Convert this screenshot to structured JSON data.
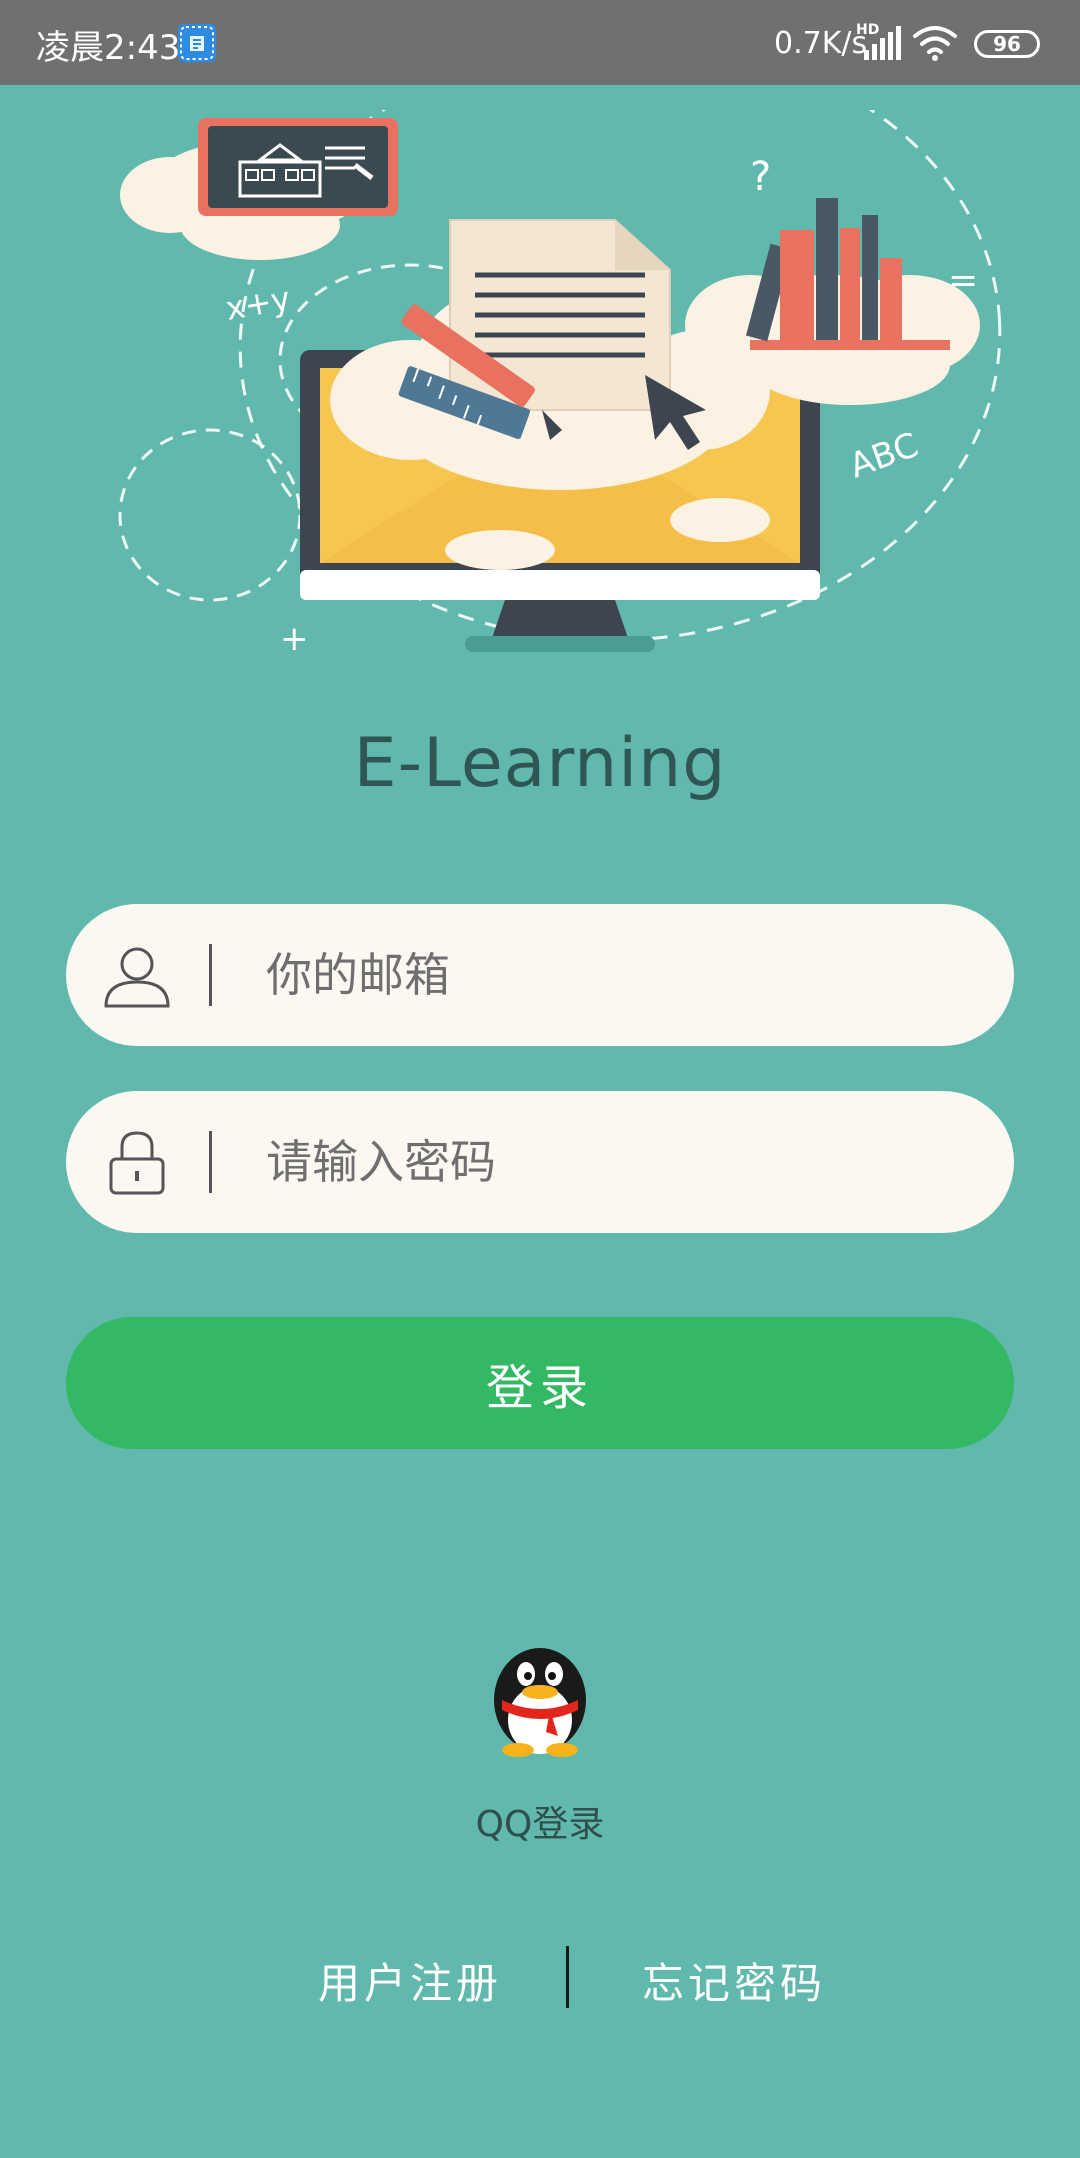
{
  "status_bar": {
    "time": "凌晨2:43",
    "network_speed": "0.7K/s",
    "signal_label": "HD",
    "battery": "96",
    "app_icon": "app-notification-icon"
  },
  "hero": {
    "image": "e-learning-illustration",
    "decor_texts": [
      "x+y",
      "?",
      "=",
      "ABC",
      "+"
    ]
  },
  "app": {
    "title": "E-Learning"
  },
  "form": {
    "email_placeholder": "你的邮箱",
    "email_icon": "user-icon",
    "password_placeholder": "请输入密码",
    "password_icon": "lock-icon",
    "login_label": "登录"
  },
  "social": {
    "qq_icon": "qq-penguin-icon",
    "qq_label": "QQ登录"
  },
  "footer": {
    "register_label": "用户注册",
    "forgot_label": "忘记密码"
  },
  "colors": {
    "background": "#61b8ad",
    "field_background": "#fbf8f1",
    "login_button": "#33b964",
    "status_bar": "#707070"
  }
}
